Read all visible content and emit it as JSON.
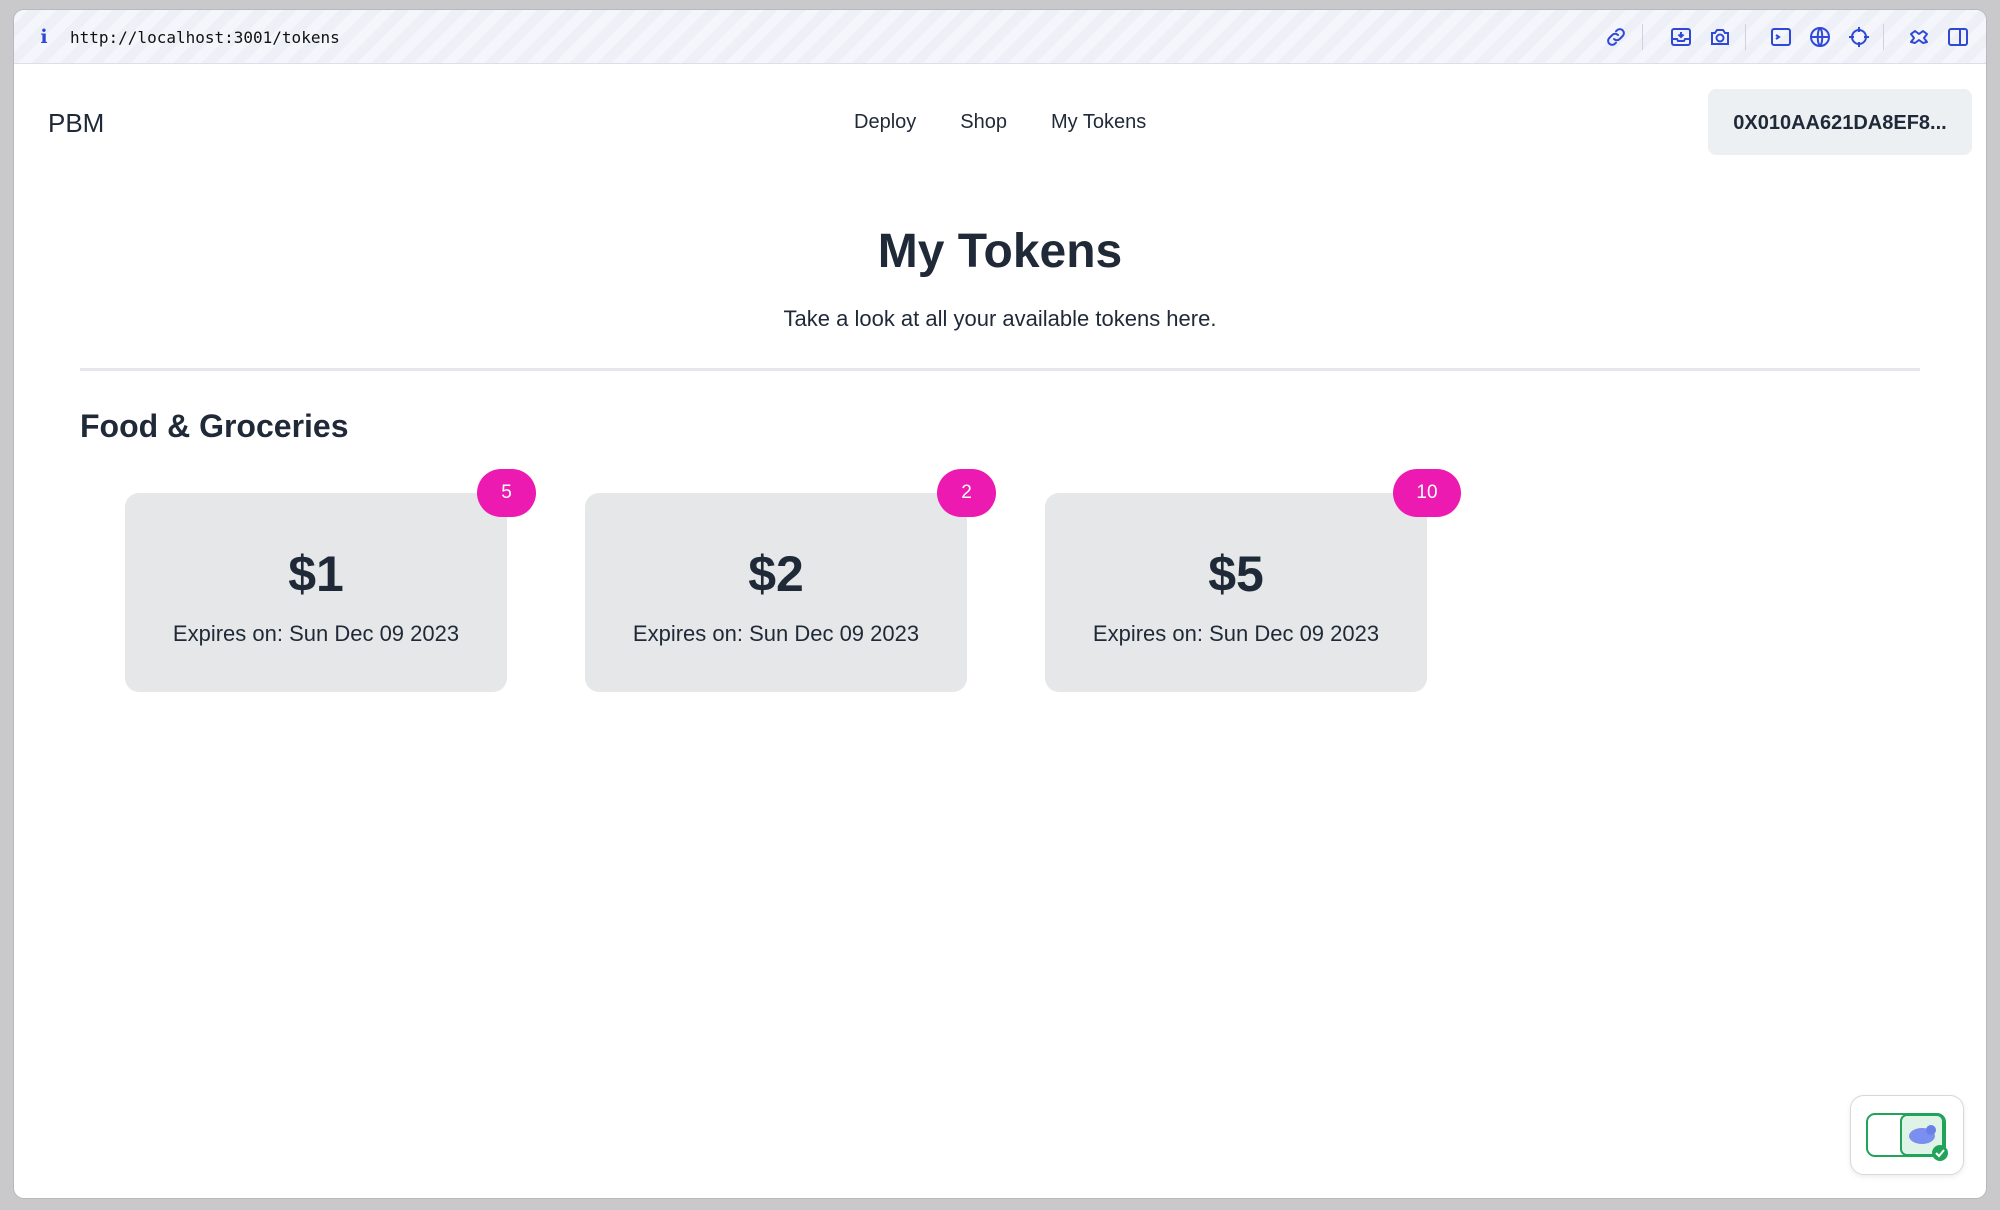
{
  "browser": {
    "url": "http://localhost:3001/tokens",
    "toolbar_icons": [
      "link-icon",
      "inbox-download-icon",
      "camera-icon",
      "terminal-icon",
      "globe-icon",
      "crosshair-icon",
      "extension-icon",
      "sidebar-toggle-icon"
    ]
  },
  "nav": {
    "brand": "PBM",
    "links": [
      "Deploy",
      "Shop",
      "My Tokens"
    ],
    "wallet": "0X010AA621DA8EF8..."
  },
  "page": {
    "title": "My Tokens",
    "subtitle": "Take a look at all your available tokens here."
  },
  "sections": [
    {
      "title": "Food & Groceries",
      "tokens": [
        {
          "amount": "$1",
          "expiry": "Expires on: Sun Dec 09 2023",
          "count": "5"
        },
        {
          "amount": "$2",
          "expiry": "Expires on: Sun Dec 09 2023",
          "count": "2"
        },
        {
          "amount": "$5",
          "expiry": "Expires on: Sun Dec 09 2023",
          "count": "10"
        }
      ]
    }
  ],
  "colors": {
    "badge": "#ec1ab0",
    "card": "#e5e7e8",
    "text": "#1f2937",
    "accent_icon": "#2f48d8"
  }
}
